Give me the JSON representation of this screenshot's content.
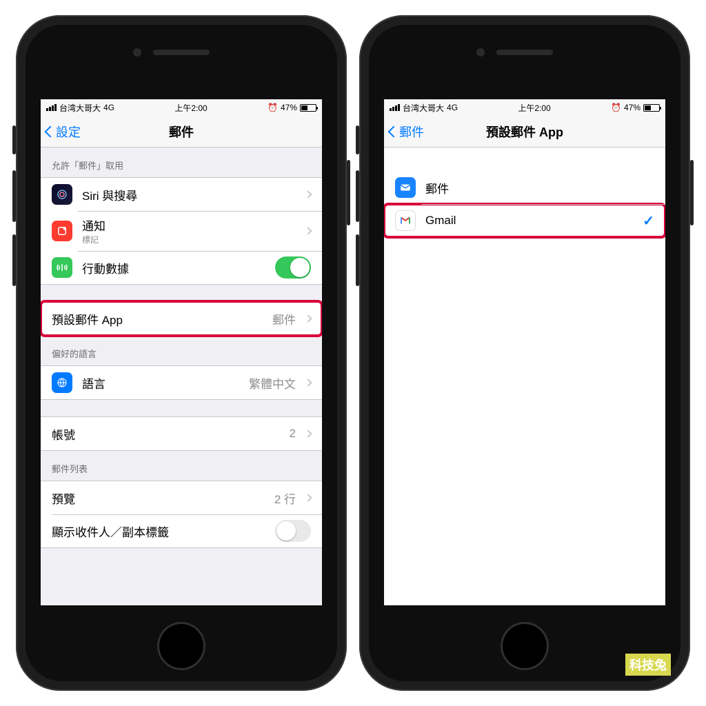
{
  "status": {
    "carrier": "台湾大哥大",
    "network": "4G",
    "time": "上午2:00",
    "battery_pct": "47%",
    "alarm": "⏰"
  },
  "left": {
    "back_label": "設定",
    "title": "郵件",
    "section_allow": "允許「郵件」取用",
    "siri": "Siri 與搜尋",
    "notif_label": "通知",
    "notif_sub": "標記",
    "cell": "行動數據",
    "default_app_label": "預設郵件 App",
    "default_app_value": "郵件",
    "section_pref": "偏好的語言",
    "lang_label": "語言",
    "lang_value": "繁體中文",
    "accounts_label": "帳號",
    "accounts_value": "2",
    "section_list": "郵件列表",
    "preview_label": "預覽",
    "preview_value": "2 行",
    "showcc_label": "顯示收件人／副本標籤"
  },
  "right": {
    "back_label": "郵件",
    "title": "預設郵件 App",
    "option_mail": "郵件",
    "option_gmail": "Gmail"
  },
  "watermark": "科技兔"
}
